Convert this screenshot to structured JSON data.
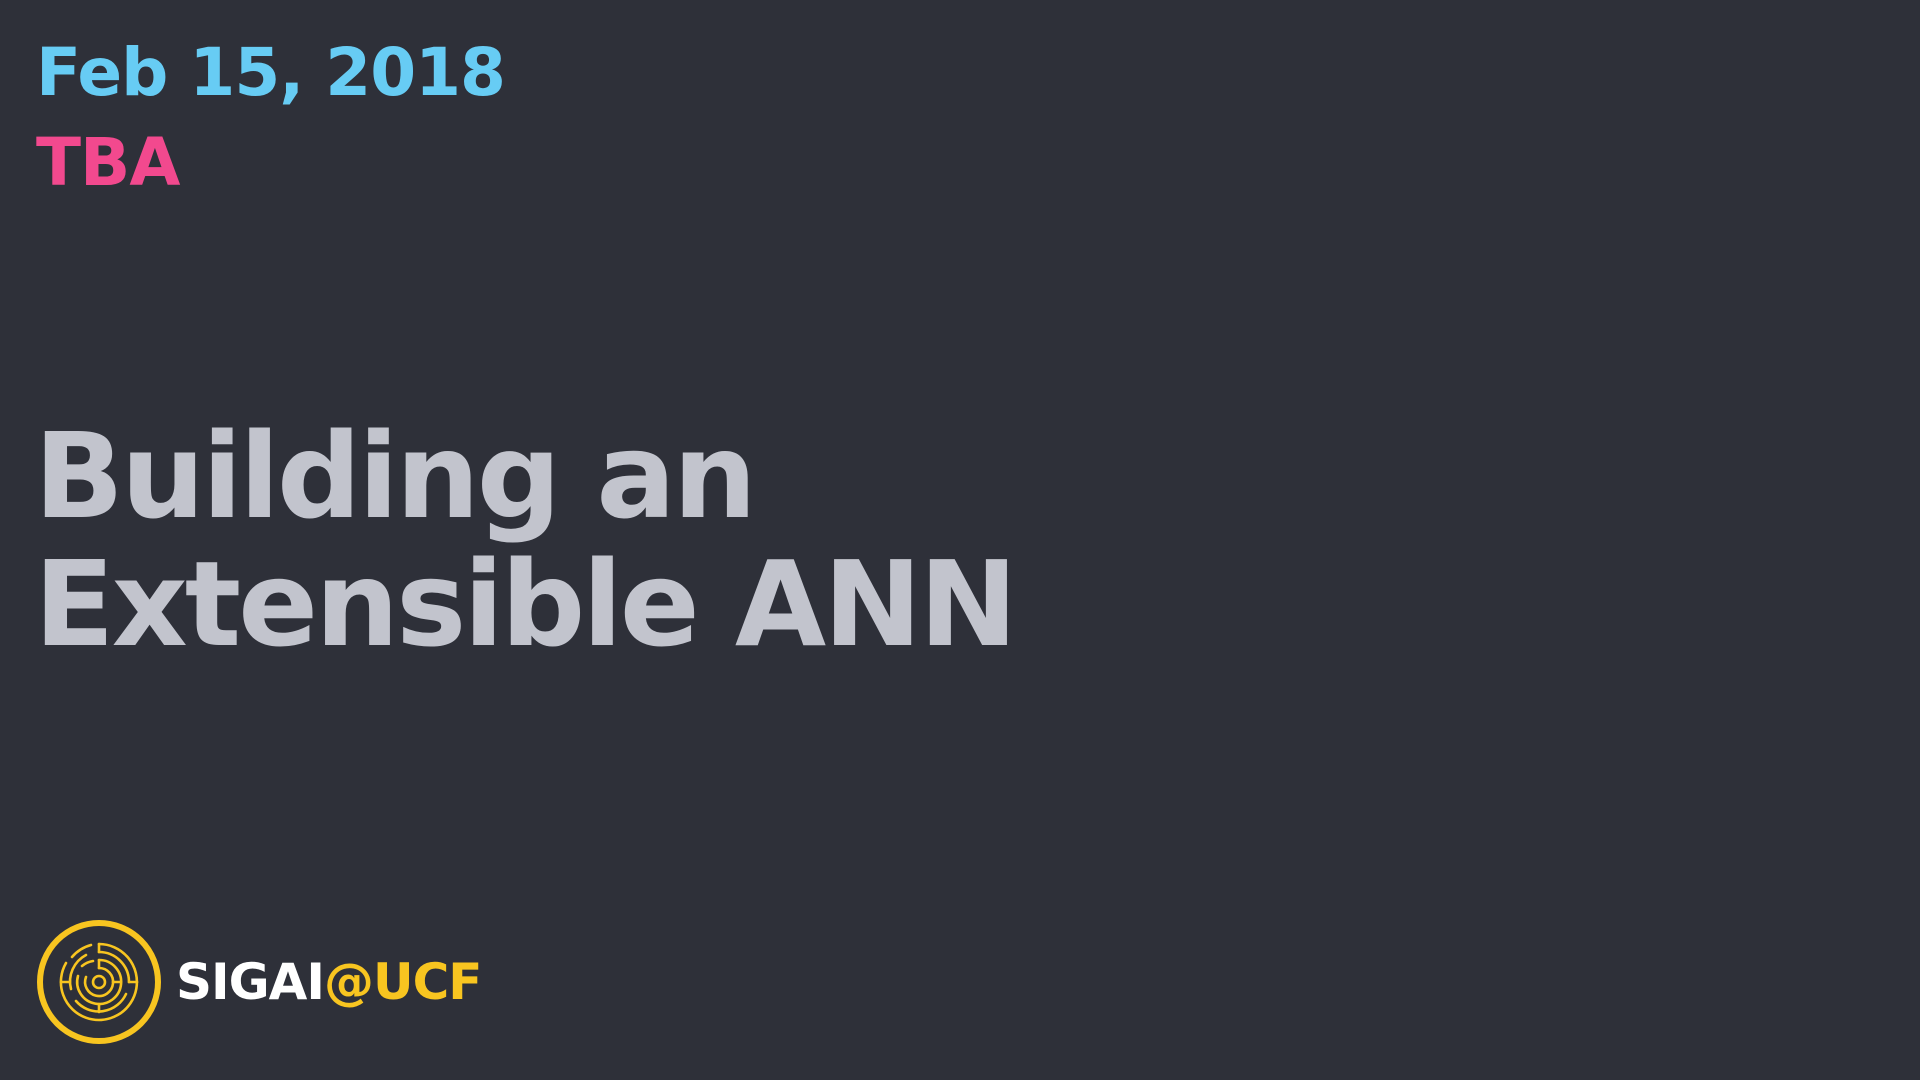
{
  "slide": {
    "date": "Feb 15, 2018",
    "speaker": "TBA",
    "title_line1": "Building an",
    "title_line2": "Extensible ANN"
  },
  "logo": {
    "icon": "maze-circle-logo-icon",
    "wordmark_primary": "SIGAI",
    "wordmark_secondary": "@UCF"
  },
  "colors": {
    "background": "#2e3039",
    "date": "#67ccf4",
    "speaker": "#f2498e",
    "title": "#c2c4cd",
    "brand_yellow": "#f8c520",
    "brand_white": "#ffffff"
  }
}
